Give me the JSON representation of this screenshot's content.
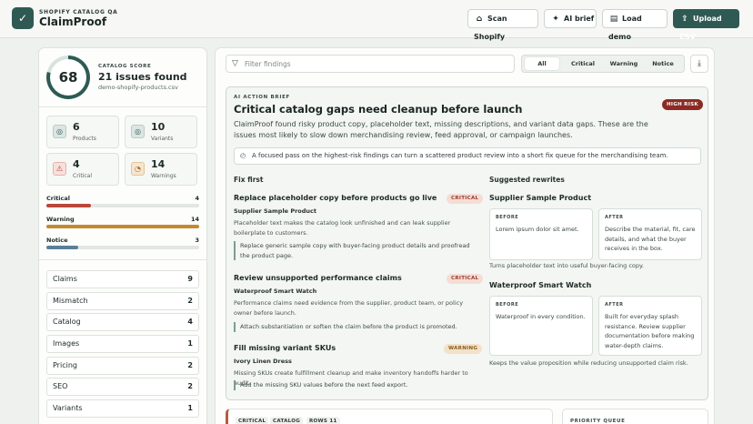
{
  "app": {
    "subtitle": "SHOPIFY CATALOG QA",
    "title": "ClaimProof",
    "logo_icon": "shield-check-icon"
  },
  "toolbar": {
    "scan": {
      "label": "Scan Shopify",
      "icon": "store-icon"
    },
    "brief": {
      "label": "AI brief",
      "icon": "sparkles-icon"
    },
    "demo": {
      "label": "Load demo",
      "icon": "file-icon"
    },
    "upload": {
      "label": "Upload CSV",
      "icon": "upload-icon"
    }
  },
  "score": {
    "label": "CATALOG SCORE",
    "value": "68",
    "fraction": 0.79,
    "title": "21 issues found",
    "file": "demo-shopify-products.csv"
  },
  "stats": [
    {
      "value": "6",
      "label": "Products",
      "icon": "box-icon"
    },
    {
      "value": "10",
      "label": "Variants",
      "icon": "layers-icon"
    },
    {
      "value": "4",
      "label": "Critical",
      "icon": "alert-triangle-icon"
    },
    {
      "value": "14",
      "label": "Warnings",
      "icon": "gauge-icon"
    }
  ],
  "severity": [
    {
      "label": "Critical",
      "count": "4",
      "fraction": 0.29,
      "color": "#b8483a"
    },
    {
      "label": "Warning",
      "count": "14",
      "fraction": 1.0,
      "color": "#c58a2e"
    },
    {
      "label": "Notice",
      "count": "3",
      "fraction": 0.21,
      "color": "#5b7f97"
    }
  ],
  "categories": [
    {
      "label": "Claims",
      "count": "9"
    },
    {
      "label": "Mismatch",
      "count": "2"
    },
    {
      "label": "Catalog",
      "count": "4"
    },
    {
      "label": "Images",
      "count": "1"
    },
    {
      "label": "Pricing",
      "count": "2"
    },
    {
      "label": "SEO",
      "count": "2"
    },
    {
      "label": "Variants",
      "count": "1"
    }
  ],
  "filter": {
    "placeholder": "Filter findings",
    "tabs": [
      "All",
      "Critical",
      "Warning",
      "Notice"
    ],
    "active": "All"
  },
  "brief": {
    "label": "AI ACTION BRIEF",
    "title": "Critical catalog gaps need cleanup before launch",
    "risk": "HIGH RISK",
    "description": "ClaimProof found risky product copy, placeholder text, missing descriptions, and variant data gaps. These are the issues most likely to slow down merchandising review, feed approval, or campaign launches.",
    "note": "A focused pass on the highest-risk findings can turn a scattered product review into a short fix queue for the merchandising team.",
    "fix_heading": "Fix first",
    "rewrite_heading": "Suggested rewrites",
    "fixes": [
      {
        "title": "Replace placeholder copy before products go live",
        "badge": "CRITICAL",
        "product": "Supplier Sample Product",
        "desc": "Placeholder text makes the catalog look unfinished and can leak supplier boilerplate to customers.",
        "action": "Replace generic sample copy with buyer-facing product details and proofread the product page."
      },
      {
        "title": "Review unsupported performance claims",
        "badge": "CRITICAL",
        "product": "Waterproof Smart Watch",
        "desc": "Performance claims need evidence from the supplier, product team, or policy owner before launch.",
        "action": "Attach substantiation or soften the claim before the product is promoted."
      },
      {
        "title": "Fill missing variant SKUs",
        "badge": "WARNING",
        "product": "Ivory Linen Dress",
        "desc": "Missing SKUs create fulfillment cleanup and make inventory handoffs harder to audit.",
        "action": "Add the missing SKU values before the next feed export."
      }
    ],
    "rewrites": [
      {
        "product": "Supplier Sample Product",
        "before_label": "BEFORE",
        "before": "Lorem ipsum dolor sit amet.",
        "after_label": "AFTER",
        "after": "Describe the material, fit, care details, and what the buyer receives in the box.",
        "note": "Turns placeholder text into useful buyer-facing copy."
      },
      {
        "product": "Waterproof Smart Watch",
        "before_label": "BEFORE",
        "before": "Waterproof in every condition.",
        "after_label": "AFTER",
        "after": "Built for everyday splash resistance. Review supplier documentation before making water-depth claims.",
        "note": "Keeps the value proposition while reducing unsupported claim risk."
      }
    ]
  },
  "next_card": {
    "tags": [
      "CRITICAL",
      "CATALOG",
      "ROWS 11"
    ]
  },
  "priority": {
    "label": "PRIORITY QUEUE"
  }
}
